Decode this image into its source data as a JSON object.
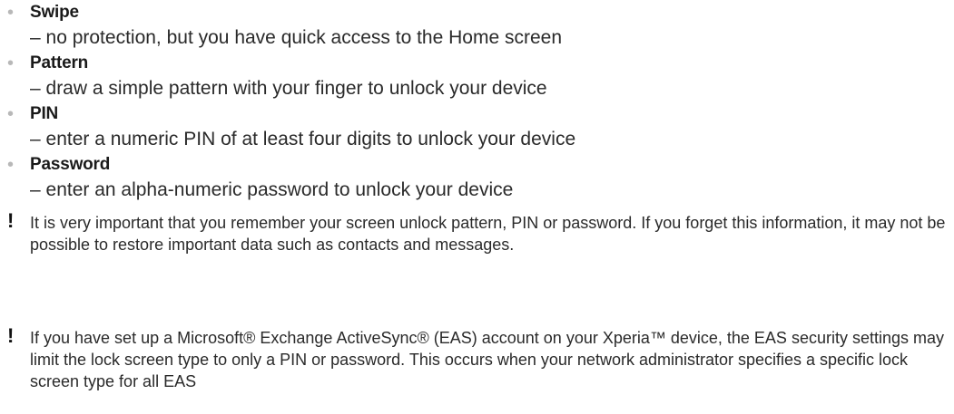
{
  "lock_types": [
    {
      "term": "Swipe",
      "description": "– no protection, but you have quick access to the Home screen"
    },
    {
      "term": "Pattern",
      "description": "– draw a simple pattern with your finger to unlock your device"
    },
    {
      "term": "PIN",
      "description": "– enter a numeric PIN of at least four digits to unlock your device"
    },
    {
      "term": "Password",
      "description": "– enter an alpha-numeric password to unlock your device"
    }
  ],
  "bullet_glyph": "•",
  "notes": [
    {
      "mark": "!",
      "text": "It is very important that you remember your screen unlock pattern, PIN or password. If you forget this information, it may not be possible to restore important data such as contacts and messages."
    },
    {
      "mark": "!",
      "text": "If you have set up a Microsoft® Exchange ActiveSync® (EAS) account on your Xperia™ device, the EAS security settings may limit the lock screen type to only a PIN or password. This occurs when your network administrator specifies a specific lock screen type for all EAS"
    }
  ],
  "colors": {
    "bullet": "#b8b8b8",
    "text": "#2a2a2a",
    "term": "#1a1a1a"
  }
}
